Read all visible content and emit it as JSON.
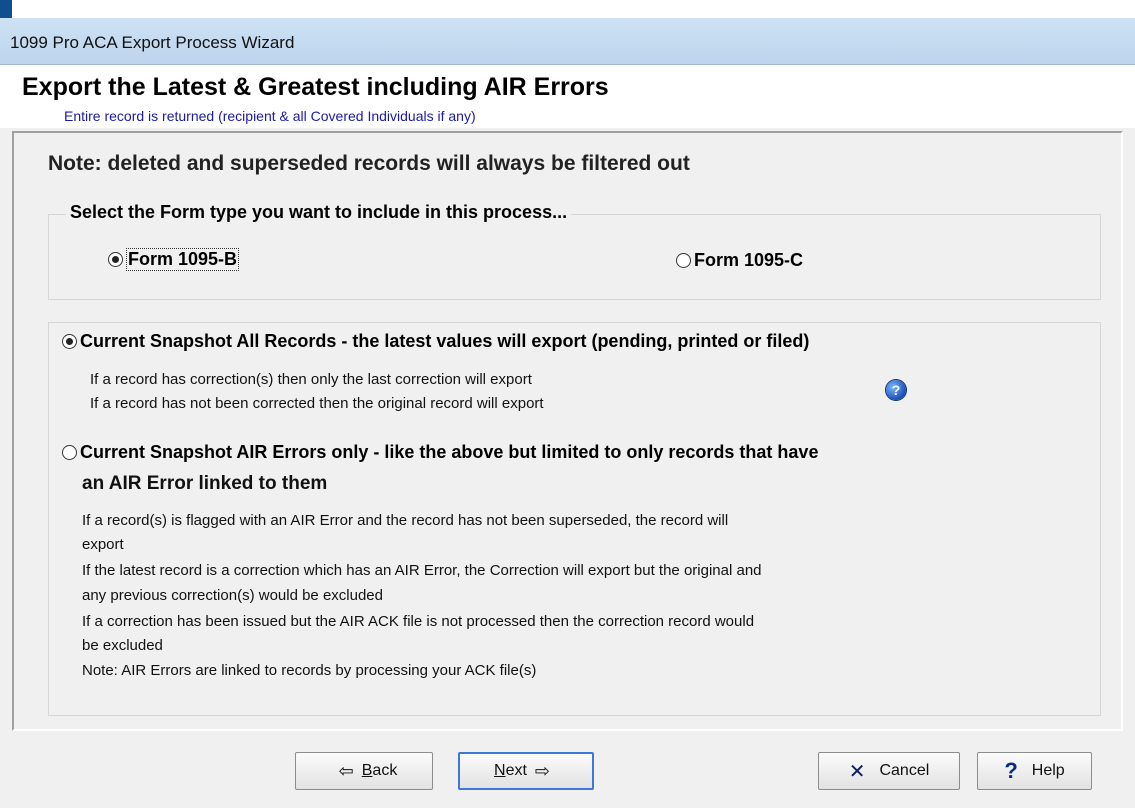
{
  "window": {
    "title": "1099 Pro ACA Export Process Wizard"
  },
  "header": {
    "title": "Export the Latest & Greatest including AIR Errors",
    "subtitle": "Entire record is returned (recipient & all Covered Individuals if any)"
  },
  "note": "Note: deleted and superseded records will always be filtered out",
  "form_type": {
    "legend": "Select the Form type you want to include in this process...",
    "options": [
      {
        "label": "Form 1095-B",
        "selected": true
      },
      {
        "label": "Form 1095-C",
        "selected": false
      }
    ]
  },
  "modes": [
    {
      "label": "Current Snapshot All Records - the latest values will export (pending, printed or filed)",
      "selected": true,
      "lines": [
        "If a record has correction(s) then only the last correction will export",
        "If a record has not been corrected then the original record will export"
      ]
    },
    {
      "label_line1": "Current Snapshot AIR Errors only - like the above but limited to only records that have",
      "label_line2": "an AIR Error linked to them",
      "selected": false,
      "lines": [
        "If a record(s) is flagged with an AIR Error and the record has not been superseded, the record will",
        "export",
        "If the latest record is a correction which has an AIR Error, the Correction will export but the original and",
        "any previous correction(s) would be excluded",
        "If a correction has been issued but the AIR ACK file is not processed then the correction record would",
        "be excluded",
        "Note:  AIR Errors are linked to records by  processing your ACK file(s)"
      ]
    }
  ],
  "buttons": {
    "back": {
      "mnemonic": "B",
      "rest": "ack"
    },
    "next": {
      "mnemonic": "N",
      "rest": "ext"
    },
    "cancel": "Cancel",
    "help": "Help"
  },
  "icons": {
    "help_circle": "help-circle-icon",
    "back_arrow": "arrow-left-icon",
    "next_arrow": "arrow-right-icon",
    "cancel_x": "x-icon",
    "help_q": "question-mark-icon"
  }
}
